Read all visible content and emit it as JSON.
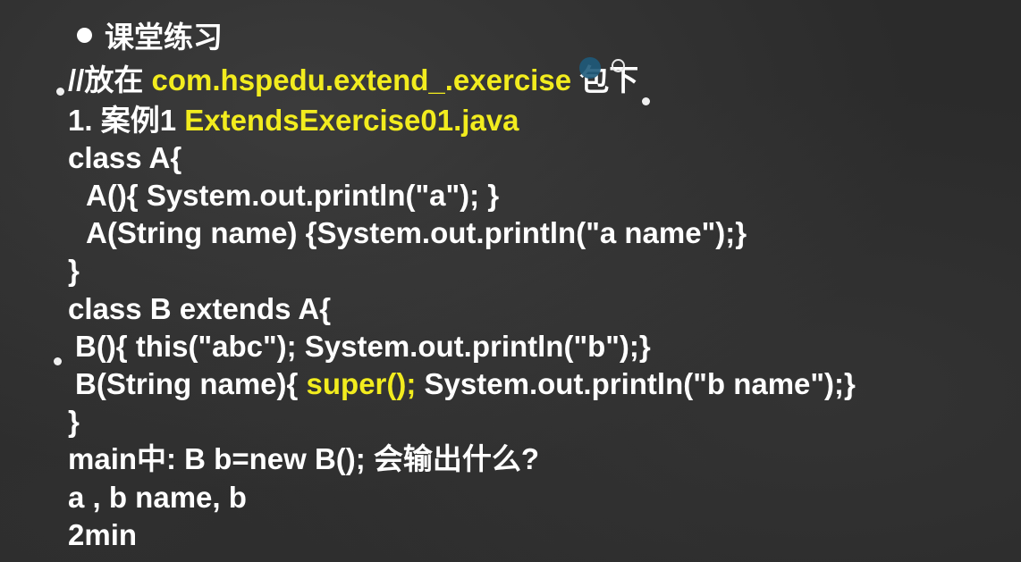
{
  "slide": {
    "heading": "课堂练习",
    "comment_prefix": "//放在",
    "package_name": "com.hspedu.extend_.exercise",
    "comment_suffix": "包下",
    "case_label": "1.  案例1",
    "case_file": "ExtendsExercise01.java",
    "code": {
      "class_a_open": "class A{",
      "a_ctor": "A(){ System.out.println(\"a\"); }",
      "a_ctor_name": "A(String name) {System.out.println(\"a name\");}",
      "class_a_close": "}",
      "class_b_open": "class B extends A{",
      "b_ctor": "B(){ this(\"abc\"); System.out.println(\"b\");}",
      "b_ctor_name_prefix": "B(String name){",
      "b_ctor_name_super": "super();",
      "b_ctor_name_suffix": "System.out.println(\"b name\");}",
      "class_b_close": "}"
    },
    "question": "main中:  B b=new B(); 会输出什么?",
    "answer": "a , b name, b",
    "time_hint": "2min"
  },
  "colors": {
    "background": "#2b2b2b",
    "text": "#ffffff",
    "highlight": "#f2ec1e"
  }
}
